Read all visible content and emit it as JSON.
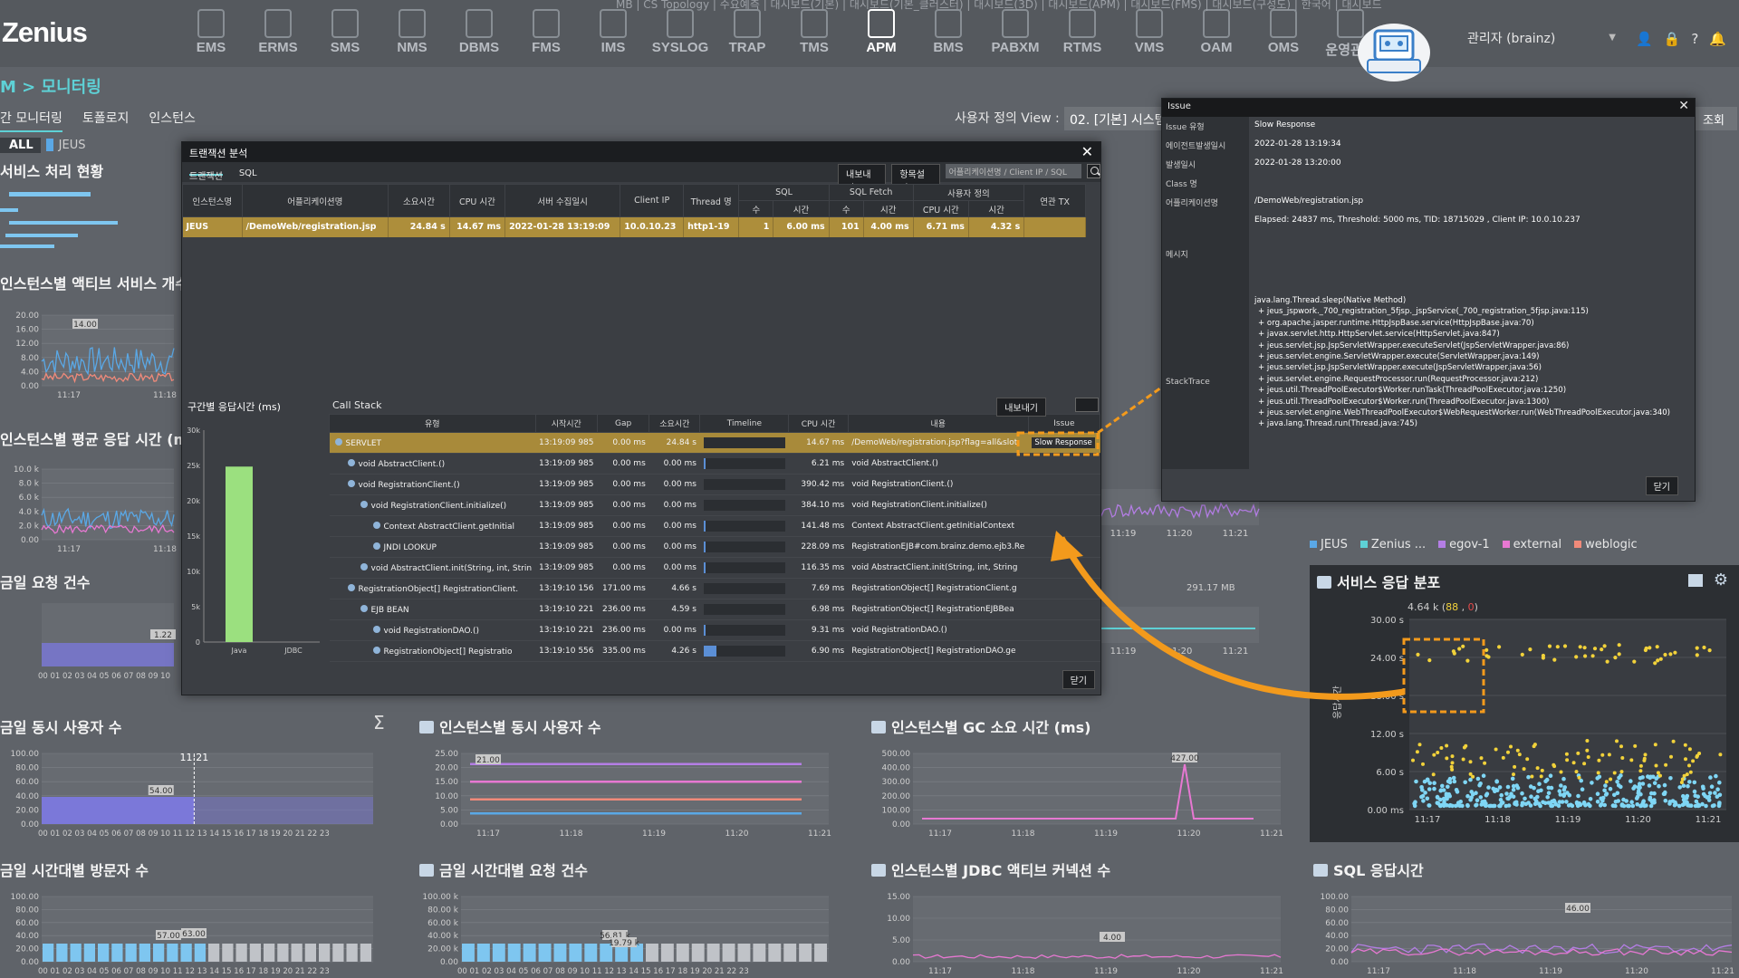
{
  "app": {
    "logo": "Zenius"
  },
  "nav": [
    {
      "label": "EMS"
    },
    {
      "label": "ERMS"
    },
    {
      "label": "SMS"
    },
    {
      "label": "NMS"
    },
    {
      "label": "DBMS"
    },
    {
      "label": "FMS"
    },
    {
      "label": "IMS"
    },
    {
      "label": "SYSLOG"
    },
    {
      "label": "TRAP"
    },
    {
      "label": "TMS"
    },
    {
      "label": "APM"
    },
    {
      "label": "BMS"
    },
    {
      "label": "PABXM"
    },
    {
      "label": "RTMS"
    },
    {
      "label": "VMS"
    },
    {
      "label": "OAM"
    },
    {
      "label": "OMS"
    },
    {
      "label": "운영관리"
    }
  ],
  "topmenu": "MB  |  CS Topology  |  수요예측  |  대시보드(기본)  |  대시보드(기본_클러스터)  |  대시보드(3D)  |  대시보드(APM)  |  대시보드(FMS)  |  대시보드(구성도)  |  한국어  |  대시보드",
  "user": {
    "name": "관리자 (brainz)"
  },
  "breadcrumb": "M > 모니터링",
  "tabs": [
    "간 모니터링",
    "토폴로지",
    "인스턴스"
  ],
  "view": {
    "label": "사용자 정의 View :",
    "value": "02. [기본] 시스템",
    "lookup": "조회"
  },
  "filter": {
    "all": "ALL",
    "jeus": "JEUS"
  },
  "panels": {
    "service_status": "서비스 처리 현황",
    "active_services": "인스턴스별 액티브 서비스 개수",
    "avg_response": "인스턴스별 평균 응답 시간 (ms)",
    "daily_requests": "금일 요청 건수",
    "concurrent_users": "금일 동시 사용자 수",
    "inst_concurrent_users": "인스턴스별 동시 사용자 수",
    "inst_gc": "인스턴스별 GC 소요 시간 (ms)",
    "hourly_visitors": "금일 시간대별 방문자 수",
    "hourly_requests": "금일 시간대별 요청 건수",
    "inst_jdbc": "인스턴스별 JDBC 액티브 커넥션 수",
    "sql_response": "SQL 응답시간",
    "dist": "서비스 응답 분포",
    "mem_label": "291.17 MB"
  },
  "mini_charts": {
    "active_services": {
      "peak": "14.00",
      "yticks": [
        "20.00",
        "16.00",
        "12.00",
        "8.00",
        "4.00",
        "0.00"
      ],
      "xticks": [
        "11:17",
        "11:18"
      ]
    },
    "avg_response": {
      "yticks": [
        "10.0 k",
        "8.0 k",
        "6.0 k",
        "4.0 k",
        "2.0 k",
        "0.00"
      ],
      "xticks": [
        "11:17",
        "11:18"
      ]
    },
    "daily_requests": {
      "peak": "1.22",
      "xticks": "00 01 02 03 04 05 06 07 08 09 10"
    },
    "concurrent_users": {
      "time": "11:21",
      "peak": "54.00",
      "yticks": [
        "100.00",
        "80.00",
        "60.00",
        "40.00",
        "20.00",
        "0.00"
      ],
      "xticks": "00 01 02 03 04 05 06 07 08 09 10 11 12 13 14 15 16 17 18 19 20 21 22 23"
    },
    "inst_users": {
      "peak": "21.00",
      "yticks": [
        "25.00",
        "20.00",
        "15.00",
        "10.00",
        "5.00",
        "0.00"
      ],
      "xticks": [
        "11:17",
        "11:18",
        "11:19",
        "11:20",
        "11:21"
      ]
    },
    "gc": {
      "peak": "427.00",
      "yticks": [
        "500.00",
        "400.00",
        "300.00",
        "200.00",
        "100.00",
        "0.00"
      ],
      "xticks": [
        "11:17",
        "11:18",
        "11:19",
        "11:20",
        "11:21"
      ]
    },
    "visitors": {
      "peak1": "57.00",
      "peak2": "63.00",
      "yticks": [
        "100.00",
        "80.00",
        "60.00",
        "40.00",
        "20.00",
        "0.00"
      ],
      "xticks": "00 01 02 03 04 05 06 07 08 09 10 11 12 13 14 15 16 17 18 19 20 21 22 23"
    },
    "hourly_req": {
      "peak1": "56.81 k",
      "peak2": "19.79 k",
      "yticks": [
        "100.00 k",
        "80.00 k",
        "60.00 k",
        "40.00 k",
        "20.00 k",
        "0.00"
      ],
      "xticks": "00 01 02 03 04 05 06 07 08 09 10 11 12 13 14 15 16 17 18 19 20 21 22 23"
    },
    "jdbc": {
      "peak": "4.00",
      "yticks": [
        "15.00",
        "10.00",
        "5.00",
        "0.00"
      ],
      "xticks": [
        "11:17",
        "11:18",
        "11:19",
        "11:20",
        "11:21"
      ]
    },
    "sql": {
      "peak": "46.00",
      "yticks": [
        "100.00",
        "80.00",
        "60.00",
        "40.00",
        "20.00",
        "0.00"
      ],
      "xticks": [
        "11:17",
        "11:18",
        "11:19",
        "11:20",
        "11:21"
      ]
    },
    "right_times": [
      "11:19",
      "11:20",
      "11:21"
    ]
  },
  "legend": [
    {
      "name": "JEUS",
      "color": "#5aa8e6"
    },
    {
      "name": "Zenius ...",
      "color": "#5ed1d6"
    },
    {
      "name": "egov-1",
      "color": "#b47ee5"
    },
    {
      "name": "external",
      "color": "#e778d2"
    },
    {
      "name": "weblogic",
      "color": "#f08a7a"
    }
  ],
  "tx": {
    "title": "트랜잭션 분석",
    "tabs": [
      "트랜잭션",
      "SQL"
    ],
    "export": "내보내기",
    "columns_btn": "항목설정",
    "search_placeholder": "어플리케이션명 / Client IP / SQL",
    "headers": [
      "인스턴스명",
      "어플리케이션명",
      "소요시간",
      "CPU 시간",
      "서버 수집일시",
      "Client IP",
      "Thread 명",
      "SQL",
      "SQL Fetch",
      "사용자 정의",
      "연관 TX"
    ],
    "subheaders": [
      "수",
      "시간",
      "수",
      "시간",
      "CPU 시간",
      "시간"
    ],
    "row": [
      "JEUS",
      "/DemoWeb/registration.jsp",
      "24.84 s",
      "14.67 ms",
      "2022-01-28 13:19:09",
      "10.0.10.23",
      "http1-19",
      "1",
      "6.00 ms",
      "101",
      "4.00 ms",
      "6.71 ms",
      "4.32 s",
      ""
    ],
    "section_resp": "구간별 응답시간 (ms)",
    "resp_chart": {
      "yticks": [
        "30k",
        "25k",
        "20k",
        "15k",
        "10k",
        "5k",
        "0"
      ],
      "cats": [
        "Java",
        "JDBC"
      ]
    },
    "callstack_title": "Call Stack",
    "cs_headers": [
      "유형",
      "시작시간",
      "Gap",
      "소요시간",
      "Timeline",
      "CPU 시간",
      "내용",
      "Issue"
    ],
    "cs_rows": [
      {
        "type": "SERVLET",
        "start": "13:19:09 985",
        "gap": "0.00 ms",
        "dur": "24.84 s",
        "tl": 0,
        "cpu": "14.67 ms",
        "content": "/DemoWeb/registration.jsp?flag=all&slot",
        "issue": "Slow Response",
        "indent": 0,
        "sel": true
      },
      {
        "type": "void AbstractClient.()",
        "start": "13:19:09 985",
        "gap": "0.00 ms",
        "dur": "0.00 ms",
        "tl": 2,
        "cpu": "6.21 ms",
        "content": "void AbstractClient.()",
        "issue": "",
        "indent": 1
      },
      {
        "type": "void RegistrationClient.()",
        "start": "13:19:09 985",
        "gap": "0.00 ms",
        "dur": "0.00 ms",
        "tl": 0,
        "cpu": "390.42 ms",
        "content": "void RegistrationClient.()",
        "issue": "",
        "indent": 1
      },
      {
        "type": "void RegistrationClient.initialize()",
        "start": "13:19:09 985",
        "gap": "0.00 ms",
        "dur": "0.00 ms",
        "tl": 0,
        "cpu": "384.10 ms",
        "content": "void RegistrationClient.initialize()",
        "issue": "",
        "indent": 2
      },
      {
        "type": "Context AbstractClient.getInitial",
        "start": "13:19:09 985",
        "gap": "0.00 ms",
        "dur": "0.00 ms",
        "tl": 2,
        "cpu": "141.48 ms",
        "content": "Context AbstractClient.getInitialContext",
        "issue": "",
        "indent": 3
      },
      {
        "type": "JNDI LOOKUP",
        "start": "13:19:09 985",
        "gap": "0.00 ms",
        "dur": "0.00 ms",
        "tl": 2,
        "cpu": "228.09 ms",
        "content": "RegistrationEJB#com.brainz.demo.ejb3.Re",
        "issue": "",
        "indent": 3
      },
      {
        "type": "void AbstractClient.init(String, int, Strin",
        "start": "13:19:09 985",
        "gap": "0.00 ms",
        "dur": "0.00 ms",
        "tl": 2,
        "cpu": "116.35 ms",
        "content": "void AbstractClient.init(String, int, String",
        "issue": "",
        "indent": 2
      },
      {
        "type": "RegistrationObject[] RegistrationClient.",
        "start": "13:19:10 156",
        "gap": "171.00 ms",
        "dur": "4.66 s",
        "tl": 0,
        "cpu": "7.69 ms",
        "content": "RegistrationObject[] RegistrationClient.g",
        "issue": "",
        "indent": 1
      },
      {
        "type": "EJB BEAN",
        "start": "13:19:10 221",
        "gap": "236.00 ms",
        "dur": "4.59 s",
        "tl": 0,
        "cpu": "6.98 ms",
        "content": "RegistrationObject[] RegistrationEJBBea",
        "issue": "",
        "indent": 2
      },
      {
        "type": "void RegistrationDAO.()",
        "start": "13:19:10 221",
        "gap": "236.00 ms",
        "dur": "0.00 ms",
        "tl": 2,
        "cpu": "9.31 ms",
        "content": "void RegistrationDAO.()",
        "issue": "",
        "indent": 3
      },
      {
        "type": "RegistrationObject[] Registratio",
        "start": "13:19:10 556",
        "gap": "335.00 ms",
        "dur": "4.26 s",
        "tl": 14,
        "cpu": "6.90 ms",
        "content": "RegistrationObject[] RegistrationDAO.ge",
        "issue": "",
        "indent": 3
      }
    ],
    "close": "닫기"
  },
  "issue": {
    "title": "Issue",
    "rows": [
      {
        "k": "Issue 유형",
        "v": "Slow Response"
      },
      {
        "k": "에이전트발생일시",
        "v": "2022-01-28 13:19:34"
      },
      {
        "k": "발생일시",
        "v": "2022-01-28 13:20:00"
      },
      {
        "k": "Class 명",
        "v": ""
      },
      {
        "k": "어플리케이션명",
        "v": "/DemoWeb/registration.jsp"
      }
    ],
    "message_label": "메시지",
    "message": "Elapsed: 24837 ms, Threshold: 5000 ms, TID: 18715029 , Client IP: 10.0.10.237",
    "stack_label": "StackTrace",
    "stack": [
      "java.lang.Thread.sleep(Native Method)",
      "+ jeus_jspwork._700_registration_5fjsp._jspService(_700_registration_5fjsp.java:115)",
      "+ org.apache.jasper.runtime.HttpJspBase.service(HttpJspBase.java:70)",
      "+ javax.servlet.http.HttpServlet.service(HttpServlet.java:847)",
      "+ jeus.servlet.jsp.JspServletWrapper.executeServlet(JspServletWrapper.java:86)",
      "+ jeus.servlet.engine.ServletWrapper.execute(ServletWrapper.java:149)",
      "+ jeus.servlet.jsp.JspServletWrapper.execute(JspServletWrapper.java:56)",
      "+ jeus.servlet.engine.RequestProcessor.run(RequestProcessor.java:212)",
      "+ jeus.util.ThreadPoolExecutor$Worker.runTask(ThreadPoolExecutor.java:1250)",
      "+ jeus.util.ThreadPoolExecutor$Worker.run(ThreadPoolExecutor.java:1300)",
      "+ jeus.servlet.engine.WebThreadPoolExecutor$WebRequestWorker.run(WebThreadPoolExecutor.java:340)",
      "+ java.lang.Thread.run(Thread.java:745)"
    ],
    "close": "닫기"
  },
  "distribution": {
    "summary": "4.64 k (",
    "count1": "88",
    "count2": "0",
    "summary_end": ")",
    "yticks": [
      "30.00 s",
      "24.00 s",
      "18.00 s",
      "12.00 s",
      "6.00 s",
      "0.00 ms"
    ],
    "xticks": [
      "11:17",
      "11:18",
      "11:19",
      "11:20",
      "11:21"
    ],
    "ylabel": "응답시간"
  }
}
